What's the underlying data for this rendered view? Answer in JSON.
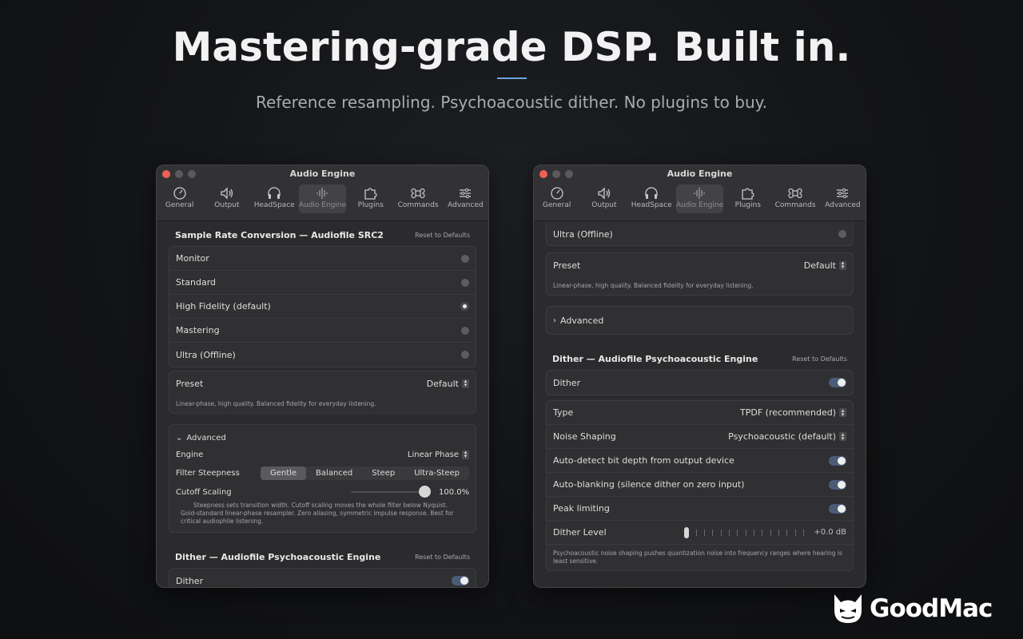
{
  "hero": {
    "title": "Mastering-grade DSP. Built in.",
    "subtitle": "Reference resampling. Psychoacoustic dither. No plugins to buy."
  },
  "window": {
    "title": "Audio Engine",
    "tabs": [
      "General",
      "Output",
      "HeadSpace",
      "Audio Engine",
      "Plugins",
      "Commands",
      "Advanced"
    ],
    "selected_tab": "Audio Engine"
  },
  "left": {
    "src_title": "Sample Rate Conversion — Audiofile SRC2",
    "reset": "Reset to Defaults",
    "quality_options": [
      "Monitor",
      "Standard",
      "High Fidelity (default)",
      "Mastering",
      "Ultra (Offline)"
    ],
    "selected_option": "High Fidelity (default)",
    "preset_label": "Preset",
    "preset_value": "Default",
    "preset_note": "Linear-phase, high quality. Balanced fidelity for everyday listening.",
    "advanced_label": "Advanced",
    "engine_label": "Engine",
    "engine_value": "Linear Phase",
    "steepness_label": "Filter Steepness",
    "steepness_options": [
      "Gentle",
      "Balanced",
      "Steep",
      "Ultra-Steep"
    ],
    "steepness_selected": "Gentle",
    "cutoff_label": "Cutoff Scaling",
    "cutoff_value": "100.0%",
    "cutoff_fraction": 1.0,
    "advanced_note_1": "Steepness sets transition width. Cutoff scaling moves the whole filter below Nyquist.",
    "advanced_note_2": "Gold-standard linear-phase resampler. Zero aliasing, symmetric impulse response. Best for critical audiophile listening.",
    "dither_title": "Dither — Audiofile Psychoacoustic Engine",
    "dither_reset": "Reset to Defaults",
    "dither_label": "Dither"
  },
  "right": {
    "ultra_label": "Ultra (Offline)",
    "preset_label": "Preset",
    "preset_value": "Default",
    "preset_note": "Linear-phase, high quality. Balanced fidelity for everyday listening.",
    "advanced_label": "Advanced",
    "dither_title": "Dither — Audiofile Psychoacoustic Engine",
    "dither_reset": "Reset to Defaults",
    "dither_label": "Dither",
    "type_label": "Type",
    "type_value": "TPDF (recommended)",
    "shaping_label": "Noise Shaping",
    "shaping_value": "Psychoacoustic (default)",
    "autodetect_label": "Auto-detect bit depth from output device",
    "autoblank_label": "Auto-blanking (silence dither on zero input)",
    "peak_label": "Peak limiting",
    "level_label": "Dither Level",
    "level_value": "+0.0 dB",
    "level_fraction": 0.0,
    "dither_note": "Psychoacoustic noise shaping pushes quantization noise into frequency ranges where hearing is least sensitive."
  },
  "brand": {
    "name": "GoodMac"
  }
}
